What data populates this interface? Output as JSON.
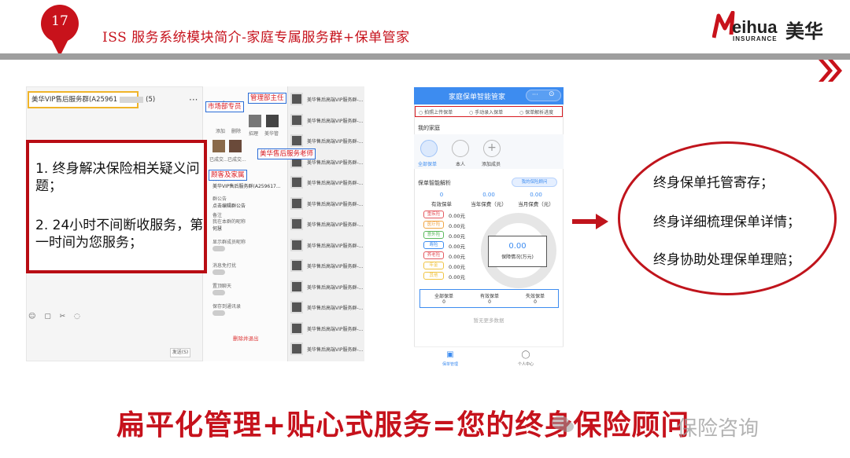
{
  "header": {
    "slide_number": "17",
    "title": "ISS 服务系统模块简介-家庭专属服务群+保单管家",
    "logo_text": "eihua",
    "logo_sub": "INSURANCE",
    "logo_cn": "美华"
  },
  "chat_window": {
    "group_title": "美华VIP售后服务群(A25961",
    "group_count": "(5)",
    "more": "···",
    "member_actions": [
      "添加",
      "删除"
    ],
    "members": [
      "招理",
      "美华管"
    ],
    "members_row2": [
      "已成交...",
      "已成交..."
    ],
    "group_name_label": "群名称",
    "group_name_value": "美华VIP售后服务群(A259617...",
    "notice_label": "群公告",
    "notice_value": "点击编辑群公告",
    "remark_label": "备注",
    "nickname_label": "我在本群的昵称",
    "nickname_value": "何慧",
    "show_nick_label": "显示群成员昵称",
    "mute_label": "消息免打扰",
    "pin_label": "置顶聊天",
    "save_label": "保存到通讯录",
    "exit_label": "删除并退出",
    "send_label": "发送(S)",
    "tool_icons": "☺ ▢ ✂ ◌",
    "tag_market": "市场部专员",
    "tag_manager": "管理部主任",
    "tag_teacher": "美华售后服务老师",
    "tag_family": "顾客及家属",
    "group_list_item": "美华售后高端VIP服务群-..."
  },
  "left_callout": {
    "point1": "1. 终身解决保险相关疑义问题；",
    "point2": "2. 24小时不间断收服务，第一时间为您服务；"
  },
  "phone": {
    "title": "家庭保单智能管家",
    "actions": [
      "拍照上传保单",
      "手动录入保单",
      "保单解析进度"
    ],
    "my_family": "我的家庭",
    "family_members": [
      "全部保单",
      "本人",
      "添加成员"
    ],
    "analysis_title": "保单智能解析",
    "consult_btn": "我的保险顾问",
    "stats": [
      {
        "value": "0",
        "label": "有效保单"
      },
      {
        "value": "0.00",
        "label": "当年保费（元）"
      },
      {
        "value": "0.00",
        "label": "当月保费（元）"
      }
    ],
    "categories": [
      {
        "name": "重疾险",
        "value": "0.00元",
        "color": "#e4595f"
      },
      {
        "name": "医疗险",
        "value": "0.00元",
        "color": "#f0a442"
      },
      {
        "name": "意外险",
        "value": "0.00元",
        "color": "#5bb85d"
      },
      {
        "name": "寿险",
        "value": "0.00元",
        "color": "#3d8cf0"
      },
      {
        "name": "养老险",
        "value": "0.00元",
        "color": "#e4595f"
      },
      {
        "name": "年金",
        "value": "0.00元",
        "color": "#f0c442"
      },
      {
        "name": "其他",
        "value": "0.00元",
        "color": "#f0c442"
      }
    ],
    "ring_value": "0.00",
    "ring_label": "保障情况(万元)",
    "table": [
      {
        "label": "全部保单",
        "value": "0"
      },
      {
        "label": "有效保单",
        "value": "0"
      },
      {
        "label": "失效保单",
        "value": "0"
      }
    ],
    "empty_text": "暂无更多数据",
    "tabs": [
      "保单管理",
      "个人中心"
    ]
  },
  "right_callout": {
    "lines": [
      "终身保单托管寄存；",
      "终身详细梳理保单详情；",
      "终身协助处理保单理赔；"
    ]
  },
  "bottom": {
    "slogan": "扁平化管理+贴心式服务=您的终身保险顾问",
    "watermark": "保险咨询"
  }
}
